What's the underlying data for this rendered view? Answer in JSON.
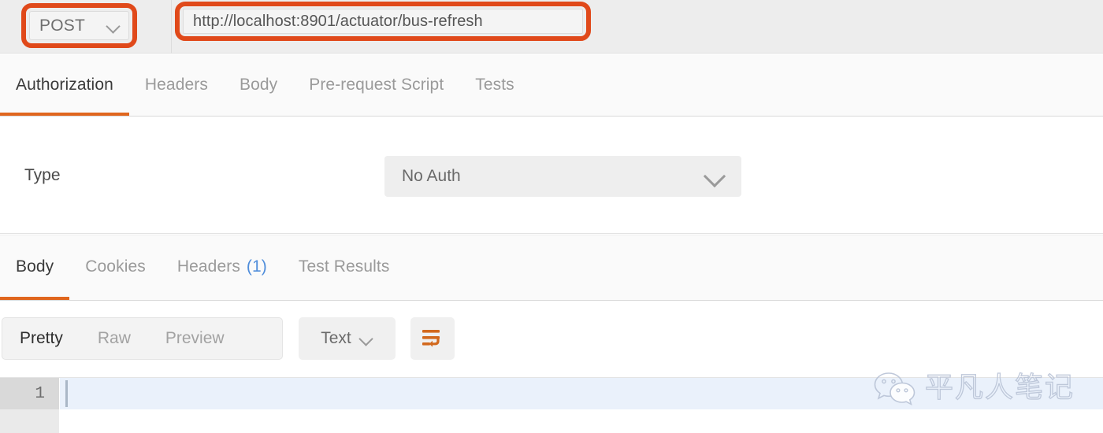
{
  "request_bar": {
    "method": "POST",
    "method_chevron_icon": "chevron-down-icon",
    "url": "http://localhost:8901/actuator/bus-refresh",
    "url_placeholder": "Enter request URL",
    "highlight_color": "#e0491a"
  },
  "request_tabs": {
    "items": [
      {
        "label": "Authorization",
        "active": true
      },
      {
        "label": "Headers",
        "active": false
      },
      {
        "label": "Body",
        "active": false
      },
      {
        "label": "Pre-request Script",
        "active": false
      },
      {
        "label": "Tests",
        "active": false
      }
    ],
    "active_underline_color": "#e0661e"
  },
  "authorization": {
    "type_label": "Type",
    "type_value": "No Auth",
    "type_chevron_icon": "chevron-down-icon"
  },
  "response_tabs": {
    "items": [
      {
        "label": "Body",
        "count": "",
        "active": true
      },
      {
        "label": "Cookies",
        "count": "",
        "active": false
      },
      {
        "label": "Headers",
        "count": "(1)",
        "active": false
      },
      {
        "label": "Test Results",
        "count": "",
        "active": false
      }
    ],
    "count_color": "#4f8ddb"
  },
  "response_toolbar": {
    "view_modes": [
      {
        "label": "Pretty",
        "active": true
      },
      {
        "label": "Raw",
        "active": false
      },
      {
        "label": "Preview",
        "active": false
      }
    ],
    "format_value": "Text",
    "format_chevron_icon": "chevron-down-icon",
    "wrap_button_icon": "word-wrap-icon",
    "wrap_icon_color": "#d2691e"
  },
  "editor": {
    "line_number": "1",
    "content": ""
  },
  "watermark": {
    "logo_icon": "wechat-icon",
    "text": "平凡人笔记"
  }
}
